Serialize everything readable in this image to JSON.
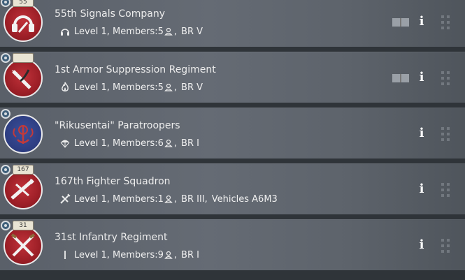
{
  "units": [
    {
      "title": "55th Signals Company",
      "meta": "Level 1, Members:5",
      "br": "BR V",
      "vehicles": "",
      "badge": "55",
      "type_icon": "headphones-icon",
      "has_manual": true,
      "emblem": "red"
    },
    {
      "title": "1st Armor Suppression Regiment",
      "meta": "Level 1, Members:5",
      "br": "BR V",
      "vehicles": "",
      "badge": "",
      "type_icon": "flame-icon",
      "has_manual": true,
      "emblem": "red"
    },
    {
      "title": "\"Rikusentai\" Paratroopers",
      "meta": "Level 1, Members:6",
      "br": "BR I",
      "vehicles": "",
      "badge": "",
      "type_icon": "parachute-icon",
      "has_manual": false,
      "emblem": "blue"
    },
    {
      "title": "167th Fighter Squadron",
      "meta": "Level 1, Members:1",
      "br": "BR III",
      "vehicles": "Vehicles A6M3",
      "badge": "167",
      "type_icon": "fighter-plane-icon",
      "has_manual": false,
      "emblem": "red"
    },
    {
      "title": "31st Infantry Regiment",
      "meta": "Level 1, Members:9",
      "br": "BR I",
      "vehicles": "",
      "badge": "31",
      "type_icon": "rifle-icon",
      "has_manual": false,
      "emblem": "red"
    }
  ],
  "info_label": "i",
  "colors": {
    "row_bg": "#5f656d",
    "text": "#ececec",
    "emblem_red": "#b02a31",
    "emblem_blue": "#2f4185"
  }
}
